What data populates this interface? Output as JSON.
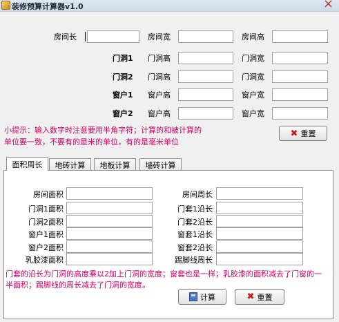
{
  "window": {
    "title": "装修预算计算器v1.0",
    "close": "×"
  },
  "top": {
    "row_room": {
      "length": "房间长",
      "width": "房间宽",
      "height": "房间高"
    },
    "row_door1": {
      "label": "门洞1",
      "height": "门洞高",
      "width": "门洞宽"
    },
    "row_door2": {
      "label": "门洞2",
      "height": "门洞高",
      "width": "门洞宽"
    },
    "row_window1": {
      "label": "窗户1",
      "height": "窗户高",
      "width": "窗户宽"
    },
    "row_window2": {
      "label": "窗户2",
      "height": "窗户高",
      "width": "窗户宽"
    }
  },
  "hint": {
    "line1": "小提示：输入数字时注意要用半角字符；计算的和被计算的",
    "line2": "单位要一致，不要有的是米的单位，有的是毫米单位"
  },
  "buttons": {
    "reset": "重置",
    "calculate": "计算"
  },
  "tabs": [
    "面积周长",
    "地砖计算",
    "地板计算",
    "墙砖计算"
  ],
  "area_tab": {
    "left_labels": [
      "房间面积",
      "门洞1面积",
      "门洞2面积",
      "窗户1面积",
      "窗户2面积",
      "乳胶漆面积"
    ],
    "right_labels": [
      "房间周长",
      "门套1沿长",
      "门套2沿长",
      "窗套1沿长",
      "窗套2沿长",
      "踢脚线周长"
    ],
    "note_line1": "门套的沿长为门洞的高度乘以2加上门洞的宽度；窗套也是一样；乳胶漆的面积减去了门窗的一",
    "note_line2": "半面积；踢脚线的周长减去了门洞的宽度。"
  }
}
